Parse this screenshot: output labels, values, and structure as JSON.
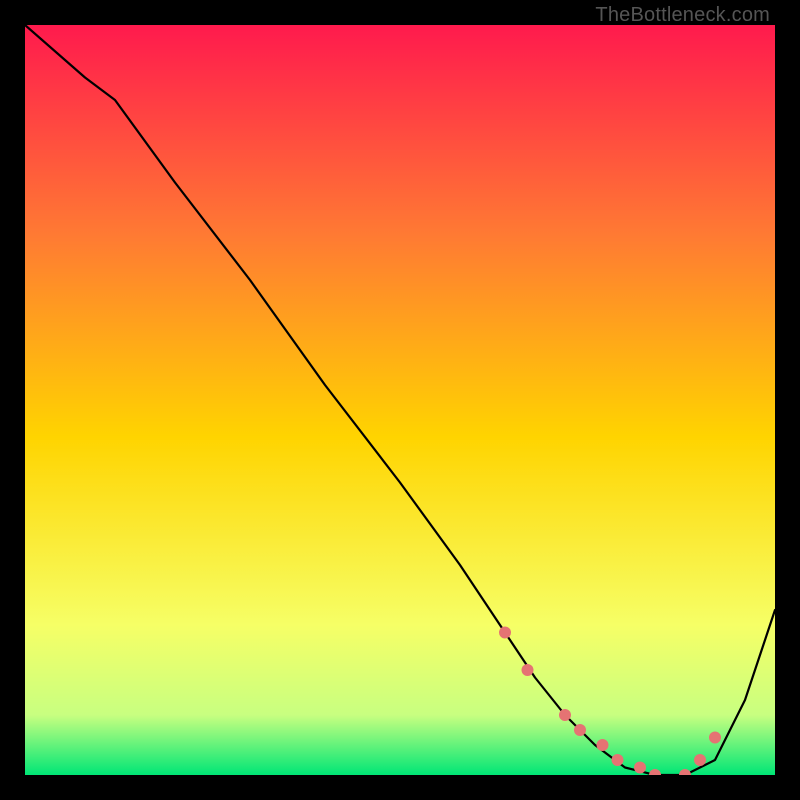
{
  "watermark": "TheBottleneck.com",
  "colors": {
    "top": "#ff1a4d",
    "q1": "#ff7a33",
    "mid": "#ffd400",
    "q3": "#f6ff66",
    "nearbot": "#c8ff80",
    "bottom": "#00e676",
    "curve": "#000000",
    "marker": "#e57373",
    "frame": "#000000"
  },
  "chart_data": {
    "type": "line",
    "title": "",
    "xlabel": "",
    "ylabel": "",
    "xlim": [
      0,
      100
    ],
    "ylim": [
      0,
      100
    ],
    "grid": false,
    "legend": false,
    "x": [
      0,
      8,
      12,
      20,
      30,
      40,
      50,
      58,
      64,
      68,
      72,
      76,
      80,
      84,
      88,
      92,
      96,
      100
    ],
    "values": [
      100,
      93,
      90,
      79,
      66,
      52,
      39,
      28,
      19,
      13,
      8,
      4,
      1,
      0,
      0,
      2,
      10,
      22
    ],
    "markers_x": [
      64,
      67,
      72,
      74,
      77,
      79,
      82,
      84,
      88,
      90,
      92
    ],
    "markers_y": [
      19,
      14,
      8,
      6,
      4,
      2,
      1,
      0,
      0,
      2,
      5
    ]
  }
}
